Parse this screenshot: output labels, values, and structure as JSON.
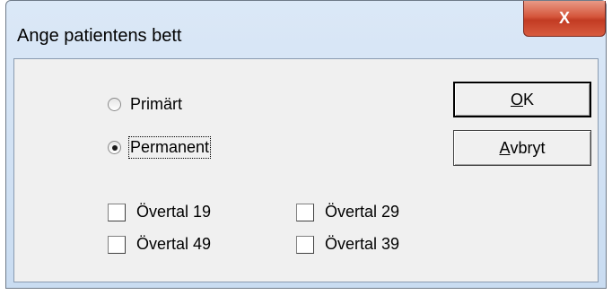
{
  "window": {
    "title": "Ange patientens bett",
    "close_glyph": "X"
  },
  "bite": {
    "options": [
      {
        "label": "Primärt",
        "selected": false
      },
      {
        "label": "Permanent",
        "selected": true
      }
    ]
  },
  "teeth": {
    "checkboxes": [
      {
        "label": "Övertal 19",
        "checked": false
      },
      {
        "label": "Övertal 29",
        "checked": false
      },
      {
        "label": "Övertal 49",
        "checked": false
      },
      {
        "label": "Övertal 39",
        "checked": false
      }
    ]
  },
  "buttons": {
    "ok": {
      "mnemonic": "O",
      "rest": "K"
    },
    "cancel": {
      "mnemonic": "A",
      "rest": "vbryt"
    }
  }
}
